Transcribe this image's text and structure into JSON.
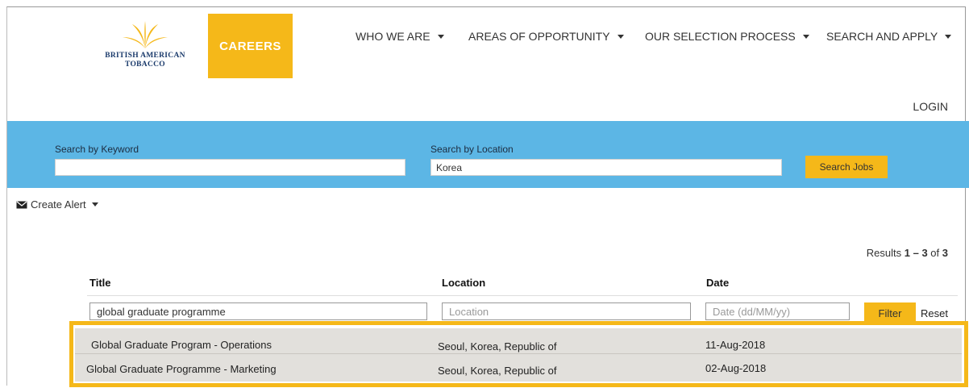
{
  "brand": {
    "logo_text_line1": "British American",
    "logo_text_line2": "Tobacco",
    "careers_label": "CAREERS",
    "accent_color": "#f5b819",
    "band_color": "#5cb6e5"
  },
  "nav": {
    "items": [
      {
        "label": "WHO WE ARE"
      },
      {
        "label": "AREAS OF OPPORTUNITY"
      },
      {
        "label": "OUR SELECTION PROCESS"
      },
      {
        "label": "SEARCH AND APPLY"
      }
    ],
    "login": "LOGIN"
  },
  "search": {
    "keyword_label": "Search by Keyword",
    "keyword_value": "",
    "location_label": "Search by Location",
    "location_value": "Korea",
    "button": "Search Jobs"
  },
  "alert": {
    "label": "Create Alert",
    "icon": "envelope-icon"
  },
  "results": {
    "prefix": "Results ",
    "range": "1 – 3",
    "suffix": " of ",
    "total": "3"
  },
  "table": {
    "headers": {
      "title": "Title",
      "location": "Location",
      "date": "Date"
    },
    "filters": {
      "title_value": "global graduate programme",
      "location_placeholder": "Location",
      "date_placeholder": "Date (dd/MM/yy)",
      "filter_button": "Filter",
      "reset": "Reset"
    },
    "rows": [
      {
        "title": "Global Graduate Program - Operations",
        "location": "Seoul, Korea, Republic of",
        "date": "11-Aug-2018"
      },
      {
        "title": "Global Graduate Programme - Marketing",
        "location": "Seoul, Korea, Republic of",
        "date": "02-Aug-2018"
      }
    ]
  }
}
